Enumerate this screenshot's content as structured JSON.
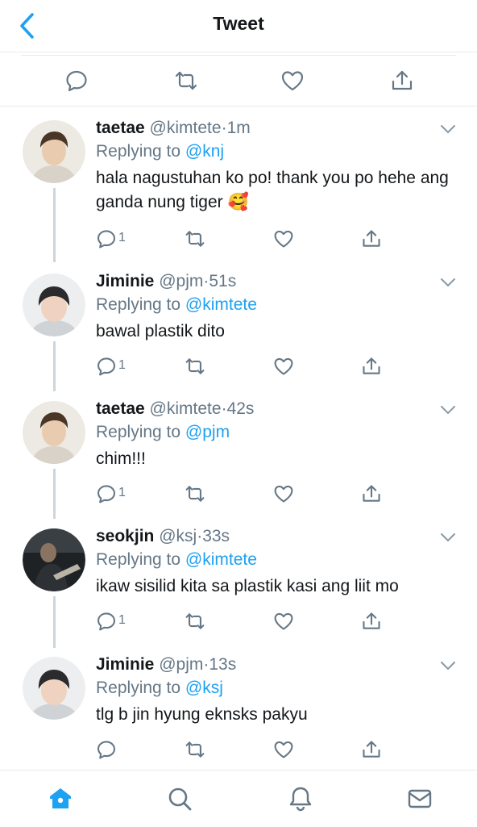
{
  "header": {
    "title": "Tweet"
  },
  "colors": {
    "accent": "#1da1f2",
    "muted": "#657786",
    "text": "#14171a"
  },
  "main_actions": [
    "reply-icon",
    "retweet-icon",
    "like-icon",
    "share-icon"
  ],
  "tweets": [
    {
      "name": "taetae",
      "handle": "@kimtete",
      "dot": "·",
      "time": "1m",
      "replying": "Replying to",
      "reply_to": "@knj",
      "text": "hala nagustuhan ko po! thank you po hehe ang ganda nung tiger 🥰",
      "reply_count": "1"
    },
    {
      "name": "Jiminie",
      "handle": "@pjm",
      "dot": "·",
      "time": "51s",
      "replying": "Replying to",
      "reply_to": "@kimtete",
      "text": "bawal plastik dito",
      "reply_count": "1"
    },
    {
      "name": "taetae",
      "handle": "@kimtete",
      "dot": "·",
      "time": "42s",
      "replying": "Replying to",
      "reply_to": "@pjm",
      "text": "chim!!!",
      "reply_count": "1"
    },
    {
      "name": "seokjin",
      "handle": "@ksj",
      "dot": "·",
      "time": "33s",
      "replying": "Replying to",
      "reply_to": "@kimtete",
      "text": "ikaw sisilid kita sa plastik kasi ang liit mo",
      "reply_count": "1"
    },
    {
      "name": "Jiminie",
      "handle": "@pjm",
      "dot": "·",
      "time": "13s",
      "replying": "Replying to",
      "reply_to": "@ksj",
      "text": "tlg b jin hyung eknsks pakyu",
      "reply_count": ""
    }
  ],
  "tabbar": [
    "home-icon",
    "search-icon",
    "notifications-icon",
    "messages-icon"
  ]
}
